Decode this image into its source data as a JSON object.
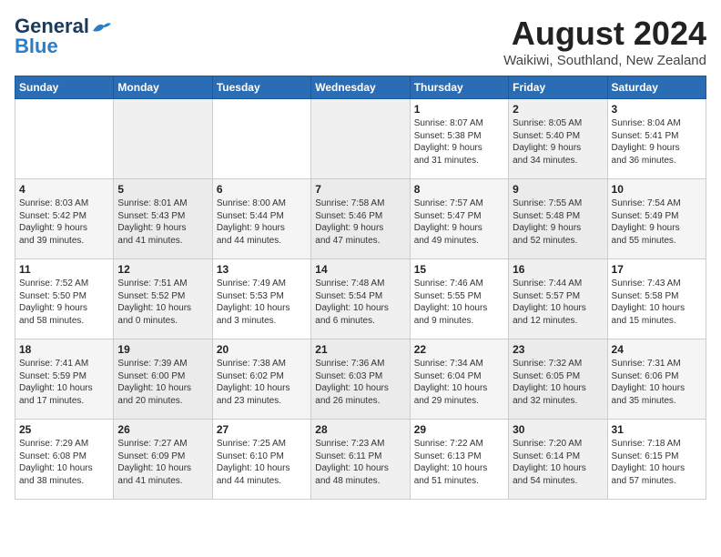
{
  "header": {
    "logo_general": "General",
    "logo_blue": "Blue",
    "month_title": "August 2024",
    "location": "Waikiwi, Southland, New Zealand"
  },
  "days_of_week": [
    "Sunday",
    "Monday",
    "Tuesday",
    "Wednesday",
    "Thursday",
    "Friday",
    "Saturday"
  ],
  "weeks": [
    [
      {
        "day": "",
        "info": ""
      },
      {
        "day": "",
        "info": ""
      },
      {
        "day": "",
        "info": ""
      },
      {
        "day": "",
        "info": ""
      },
      {
        "day": "1",
        "info": "Sunrise: 8:07 AM\nSunset: 5:38 PM\nDaylight: 9 hours\nand 31 minutes."
      },
      {
        "day": "2",
        "info": "Sunrise: 8:05 AM\nSunset: 5:40 PM\nDaylight: 9 hours\nand 34 minutes."
      },
      {
        "day": "3",
        "info": "Sunrise: 8:04 AM\nSunset: 5:41 PM\nDaylight: 9 hours\nand 36 minutes."
      }
    ],
    [
      {
        "day": "4",
        "info": "Sunrise: 8:03 AM\nSunset: 5:42 PM\nDaylight: 9 hours\nand 39 minutes."
      },
      {
        "day": "5",
        "info": "Sunrise: 8:01 AM\nSunset: 5:43 PM\nDaylight: 9 hours\nand 41 minutes."
      },
      {
        "day": "6",
        "info": "Sunrise: 8:00 AM\nSunset: 5:44 PM\nDaylight: 9 hours\nand 44 minutes."
      },
      {
        "day": "7",
        "info": "Sunrise: 7:58 AM\nSunset: 5:46 PM\nDaylight: 9 hours\nand 47 minutes."
      },
      {
        "day": "8",
        "info": "Sunrise: 7:57 AM\nSunset: 5:47 PM\nDaylight: 9 hours\nand 49 minutes."
      },
      {
        "day": "9",
        "info": "Sunrise: 7:55 AM\nSunset: 5:48 PM\nDaylight: 9 hours\nand 52 minutes."
      },
      {
        "day": "10",
        "info": "Sunrise: 7:54 AM\nSunset: 5:49 PM\nDaylight: 9 hours\nand 55 minutes."
      }
    ],
    [
      {
        "day": "11",
        "info": "Sunrise: 7:52 AM\nSunset: 5:50 PM\nDaylight: 9 hours\nand 58 minutes."
      },
      {
        "day": "12",
        "info": "Sunrise: 7:51 AM\nSunset: 5:52 PM\nDaylight: 10 hours\nand 0 minutes."
      },
      {
        "day": "13",
        "info": "Sunrise: 7:49 AM\nSunset: 5:53 PM\nDaylight: 10 hours\nand 3 minutes."
      },
      {
        "day": "14",
        "info": "Sunrise: 7:48 AM\nSunset: 5:54 PM\nDaylight: 10 hours\nand 6 minutes."
      },
      {
        "day": "15",
        "info": "Sunrise: 7:46 AM\nSunset: 5:55 PM\nDaylight: 10 hours\nand 9 minutes."
      },
      {
        "day": "16",
        "info": "Sunrise: 7:44 AM\nSunset: 5:57 PM\nDaylight: 10 hours\nand 12 minutes."
      },
      {
        "day": "17",
        "info": "Sunrise: 7:43 AM\nSunset: 5:58 PM\nDaylight: 10 hours\nand 15 minutes."
      }
    ],
    [
      {
        "day": "18",
        "info": "Sunrise: 7:41 AM\nSunset: 5:59 PM\nDaylight: 10 hours\nand 17 minutes."
      },
      {
        "day": "19",
        "info": "Sunrise: 7:39 AM\nSunset: 6:00 PM\nDaylight: 10 hours\nand 20 minutes."
      },
      {
        "day": "20",
        "info": "Sunrise: 7:38 AM\nSunset: 6:02 PM\nDaylight: 10 hours\nand 23 minutes."
      },
      {
        "day": "21",
        "info": "Sunrise: 7:36 AM\nSunset: 6:03 PM\nDaylight: 10 hours\nand 26 minutes."
      },
      {
        "day": "22",
        "info": "Sunrise: 7:34 AM\nSunset: 6:04 PM\nDaylight: 10 hours\nand 29 minutes."
      },
      {
        "day": "23",
        "info": "Sunrise: 7:32 AM\nSunset: 6:05 PM\nDaylight: 10 hours\nand 32 minutes."
      },
      {
        "day": "24",
        "info": "Sunrise: 7:31 AM\nSunset: 6:06 PM\nDaylight: 10 hours\nand 35 minutes."
      }
    ],
    [
      {
        "day": "25",
        "info": "Sunrise: 7:29 AM\nSunset: 6:08 PM\nDaylight: 10 hours\nand 38 minutes."
      },
      {
        "day": "26",
        "info": "Sunrise: 7:27 AM\nSunset: 6:09 PM\nDaylight: 10 hours\nand 41 minutes."
      },
      {
        "day": "27",
        "info": "Sunrise: 7:25 AM\nSunset: 6:10 PM\nDaylight: 10 hours\nand 44 minutes."
      },
      {
        "day": "28",
        "info": "Sunrise: 7:23 AM\nSunset: 6:11 PM\nDaylight: 10 hours\nand 48 minutes."
      },
      {
        "day": "29",
        "info": "Sunrise: 7:22 AM\nSunset: 6:13 PM\nDaylight: 10 hours\nand 51 minutes."
      },
      {
        "day": "30",
        "info": "Sunrise: 7:20 AM\nSunset: 6:14 PM\nDaylight: 10 hours\nand 54 minutes."
      },
      {
        "day": "31",
        "info": "Sunrise: 7:18 AM\nSunset: 6:15 PM\nDaylight: 10 hours\nand 57 minutes."
      }
    ]
  ]
}
